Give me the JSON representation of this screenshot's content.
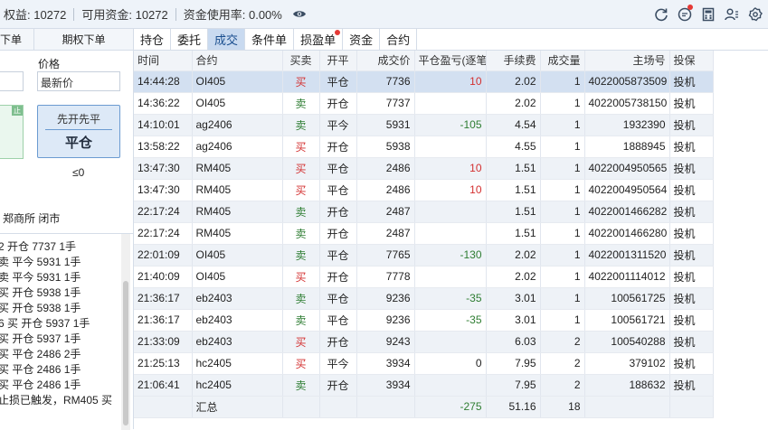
{
  "header": {
    "equity_label": "权益: 10272",
    "available_label": "可用资金: 10272",
    "usage_label": "资金使用率: 0.00%"
  },
  "left": {
    "tab_cut": "下单",
    "tab_option": "期权下单",
    "price_label": "价格",
    "price_value": "最新价",
    "stop_tag": "止",
    "close_btn_sub": "先开先平",
    "close_btn_main": "平仓",
    "le_zero": "≤0",
    "exchange_status": "郑商所 闭市",
    "logs": [
      "2 开仓 7737 1手",
      "卖 平今 5931 1手",
      "卖 平今 5931 1手",
      "买 开仓 5938 1手",
      "买 开仓 5938 1手",
      "6 买 开仓 5937 1手",
      "买 开仓 5937 1手",
      "买 平仓 2486 2手",
      "买 平仓 2486 1手",
      "买 平仓 2486 1手",
      "止损已触发，RM405 买"
    ]
  },
  "tabs": [
    "持仓",
    "委托",
    "成交",
    "条件单",
    "损盈单",
    "资金",
    "合约"
  ],
  "active_tab": "成交",
  "table": {
    "headers": [
      "时间",
      "合约",
      "买卖",
      "开平",
      "成交价",
      "平仓盈亏(逐笔",
      "手续费",
      "成交量",
      "主场号",
      "投保"
    ],
    "rows": [
      {
        "time": "14:44:28",
        "contract": "OI405",
        "side": "买",
        "oc": "平仓",
        "price": "7736",
        "pnl": "10",
        "fee": "2.02",
        "qty": "1",
        "id": "4022005873509",
        "hedge": "投机"
      },
      {
        "time": "14:36:22",
        "contract": "OI405",
        "side": "卖",
        "oc": "开仓",
        "price": "7737",
        "pnl": "",
        "fee": "2.02",
        "qty": "1",
        "id": "4022005738150",
        "hedge": "投机"
      },
      {
        "time": "14:10:01",
        "contract": "ag2406",
        "side": "卖",
        "oc": "平今",
        "price": "5931",
        "pnl": "-105",
        "fee": "4.54",
        "qty": "1",
        "id": "1932390",
        "hedge": "投机"
      },
      {
        "time": "13:58:22",
        "contract": "ag2406",
        "side": "买",
        "oc": "开仓",
        "price": "5938",
        "pnl": "",
        "fee": "4.55",
        "qty": "1",
        "id": "1888945",
        "hedge": "投机"
      },
      {
        "time": "13:47:30",
        "contract": "RM405",
        "side": "买",
        "oc": "平仓",
        "price": "2486",
        "pnl": "10",
        "fee": "1.51",
        "qty": "1",
        "id": "4022004950565",
        "hedge": "投机"
      },
      {
        "time": "13:47:30",
        "contract": "RM405",
        "side": "买",
        "oc": "平仓",
        "price": "2486",
        "pnl": "10",
        "fee": "1.51",
        "qty": "1",
        "id": "4022004950564",
        "hedge": "投机"
      },
      {
        "time": "22:17:24",
        "contract": "RM405",
        "side": "卖",
        "oc": "开仓",
        "price": "2487",
        "pnl": "",
        "fee": "1.51",
        "qty": "1",
        "id": "4022001466282",
        "hedge": "投机"
      },
      {
        "time": "22:17:24",
        "contract": "RM405",
        "side": "卖",
        "oc": "开仓",
        "price": "2487",
        "pnl": "",
        "fee": "1.51",
        "qty": "1",
        "id": "4022001466280",
        "hedge": "投机"
      },
      {
        "time": "22:01:09",
        "contract": "OI405",
        "side": "卖",
        "oc": "平仓",
        "price": "7765",
        "pnl": "-130",
        "fee": "2.02",
        "qty": "1",
        "id": "4022001311520",
        "hedge": "投机"
      },
      {
        "time": "21:40:09",
        "contract": "OI405",
        "side": "买",
        "oc": "开仓",
        "price": "7778",
        "pnl": "",
        "fee": "2.02",
        "qty": "1",
        "id": "4022001114012",
        "hedge": "投机"
      },
      {
        "time": "21:36:17",
        "contract": "eb2403",
        "side": "卖",
        "oc": "平仓",
        "price": "9236",
        "pnl": "-35",
        "fee": "3.01",
        "qty": "1",
        "id": "100561725",
        "hedge": "投机"
      },
      {
        "time": "21:36:17",
        "contract": "eb2403",
        "side": "卖",
        "oc": "平仓",
        "price": "9236",
        "pnl": "-35",
        "fee": "3.01",
        "qty": "1",
        "id": "100561721",
        "hedge": "投机"
      },
      {
        "time": "21:33:09",
        "contract": "eb2403",
        "side": "买",
        "oc": "开仓",
        "price": "9243",
        "pnl": "",
        "fee": "6.03",
        "qty": "2",
        "id": "100540288",
        "hedge": "投机"
      },
      {
        "time": "21:25:13",
        "contract": "hc2405",
        "side": "买",
        "oc": "平今",
        "price": "3934",
        "pnl": "0",
        "fee": "7.95",
        "qty": "2",
        "id": "379102",
        "hedge": "投机"
      },
      {
        "time": "21:06:41",
        "contract": "hc2405",
        "side": "卖",
        "oc": "开仓",
        "price": "3934",
        "pnl": "",
        "fee": "7.95",
        "qty": "2",
        "id": "188632",
        "hedge": "投机"
      }
    ],
    "footer": {
      "label": "汇总",
      "pnl": "-275",
      "fee": "51.16",
      "qty": "18"
    }
  }
}
